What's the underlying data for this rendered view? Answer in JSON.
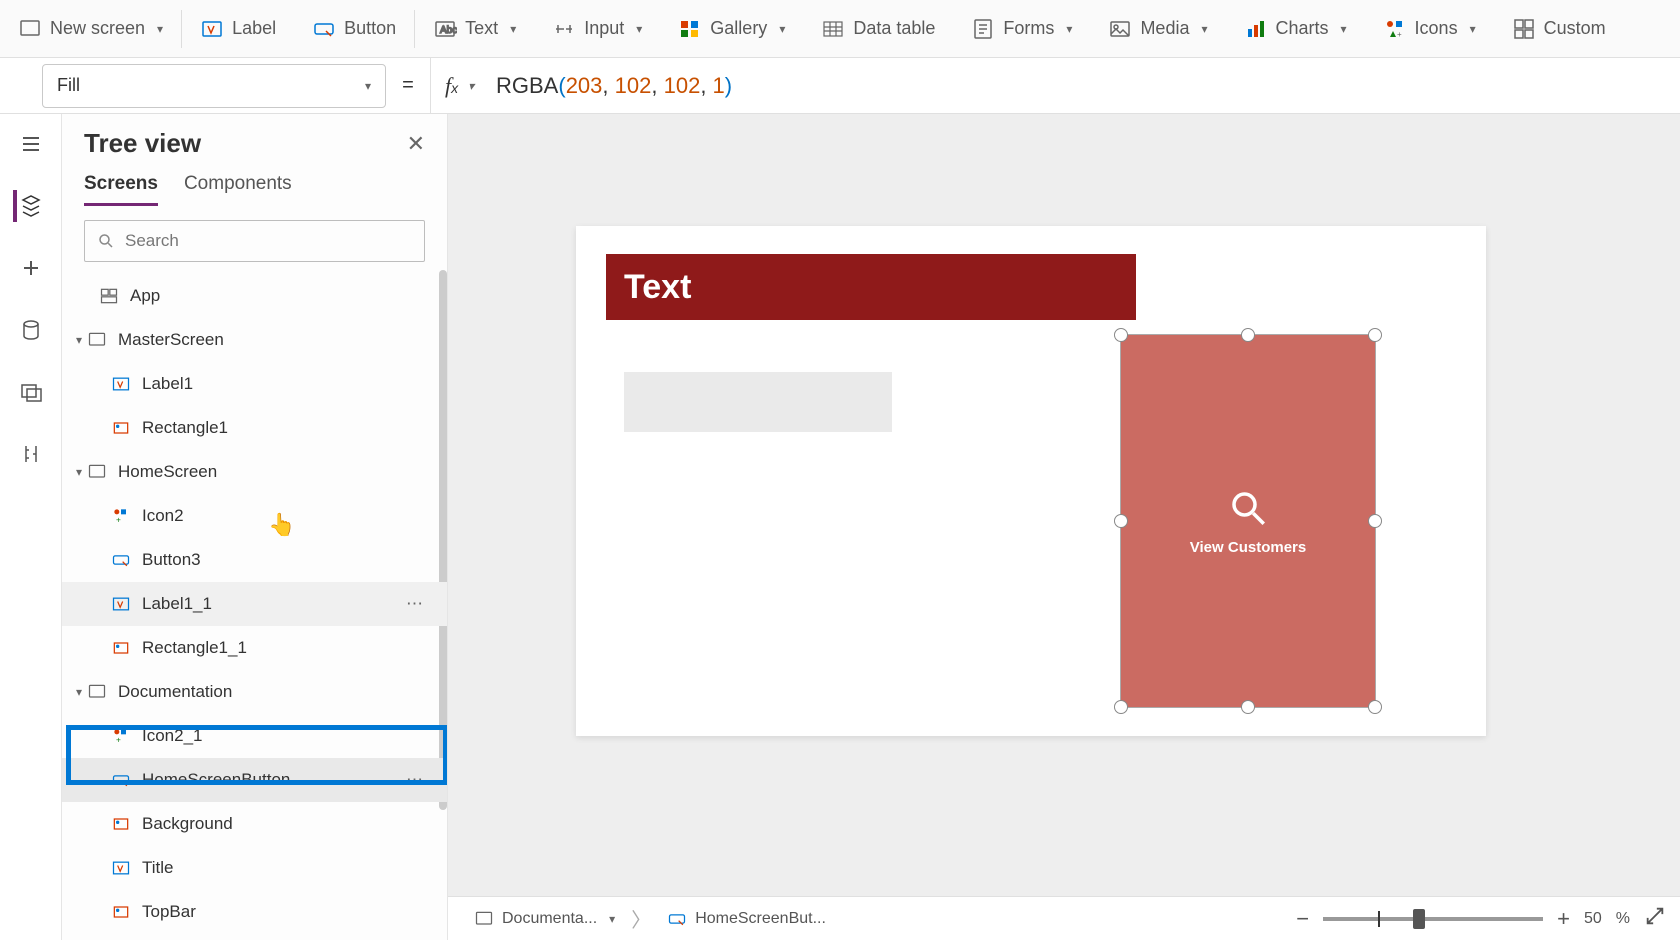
{
  "ribbon": {
    "new_screen": "New screen",
    "label": "Label",
    "button": "Button",
    "text": "Text",
    "input": "Input",
    "gallery": "Gallery",
    "data_table": "Data table",
    "forms": "Forms",
    "media": "Media",
    "charts": "Charts",
    "icons": "Icons",
    "custom": "Custom"
  },
  "formula": {
    "property": "Fill",
    "fn": "RGBA",
    "args": [
      "203",
      "102",
      "102",
      "1"
    ]
  },
  "panel": {
    "title": "Tree view",
    "tabs": {
      "screens": "Screens",
      "components": "Components"
    },
    "search_placeholder": "Search"
  },
  "tree": {
    "app": "App",
    "master_screen": "MasterScreen",
    "label1": "Label1",
    "rectangle1": "Rectangle1",
    "home_screen": "HomeScreen",
    "icon2": "Icon2",
    "button3": "Button3",
    "label1_1": "Label1_1",
    "rectangle1_1": "Rectangle1_1",
    "documentation": "Documentation",
    "icon2_1": "Icon2_1",
    "home_screen_button": "HomeScreenButton",
    "background": "Background",
    "title": "Title",
    "topbar": "TopBar"
  },
  "canvas": {
    "header_text": "Text",
    "button_label": "View Customers"
  },
  "status": {
    "crumb1": "Documenta...",
    "crumb2": "HomeScreenBut...",
    "zoom": "50",
    "pct": "%"
  }
}
